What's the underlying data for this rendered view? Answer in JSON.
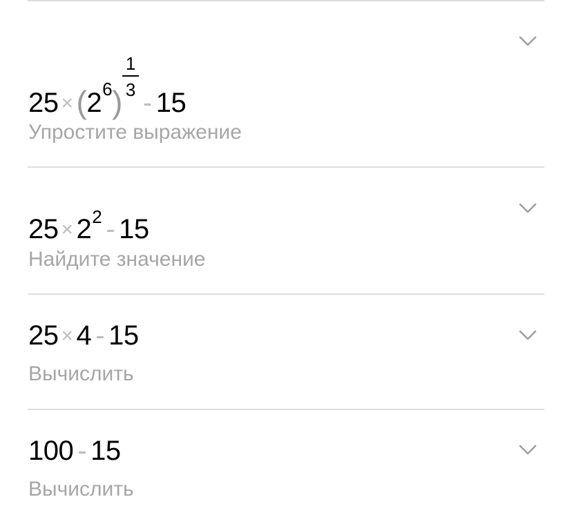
{
  "steps": [
    {
      "expression": {
        "a": "25",
        "times": "×",
        "open_paren": "(",
        "base": "2",
        "inner_exp": "6",
        "close_paren": ")",
        "frac_num": "1",
        "frac_den": "3",
        "minus": "-",
        "b": "15"
      },
      "label": "Упростите выражение"
    },
    {
      "expression": {
        "a": "25",
        "times": "×",
        "base": "2",
        "exp": "2",
        "minus": "-",
        "b": "15"
      },
      "label": "Найдите значение"
    },
    {
      "expression": {
        "a": "25",
        "times": "×",
        "c": "4",
        "minus": "-",
        "b": "15"
      },
      "label": "Вычислить"
    },
    {
      "expression": {
        "a": "100",
        "minus": "-",
        "b": "15"
      },
      "label": "Вычислить"
    }
  ],
  "icons": {
    "chevron": "chevron-down-icon"
  },
  "colors": {
    "operator": "#bdbdbd",
    "label": "#a6a6a6",
    "divider": "#dedede",
    "chevron": "#9e9e9e"
  }
}
